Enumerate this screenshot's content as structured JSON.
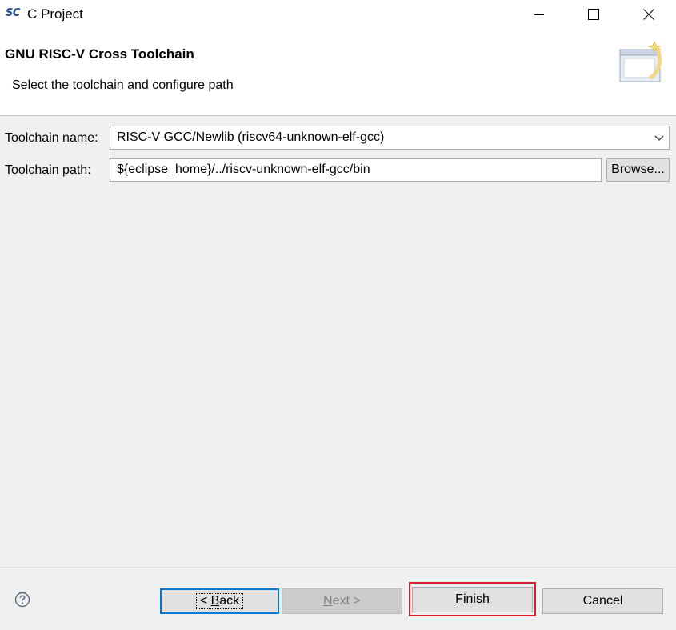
{
  "window": {
    "app_icon_text": "SC",
    "title": "C Project"
  },
  "header": {
    "title": "GNU RISC-V Cross Toolchain",
    "description": "Select the toolchain and configure path",
    "banner_icon": "new-wizard-banner-icon"
  },
  "form": {
    "toolchain_name_label": "Toolchain name:",
    "toolchain_name_value": "RISC-V GCC/Newlib (riscv64-unknown-elf-gcc)",
    "toolchain_path_label": "Toolchain path:",
    "toolchain_path_value": "${eclipse_home}/../riscv-unknown-elf-gcc/bin",
    "browse_label": "Browse..."
  },
  "footer": {
    "help_icon": "question-circle-icon",
    "back_prefix": "< ",
    "back_mnemonic": "B",
    "back_rest": "ack",
    "next_mnemonic": "N",
    "next_rest": "ext >",
    "finish_mnemonic": "F",
    "finish_rest": "inish",
    "cancel_label": "Cancel"
  },
  "colors": {
    "highlight_frame": "#d6202a",
    "focus_border": "#0078d7"
  }
}
